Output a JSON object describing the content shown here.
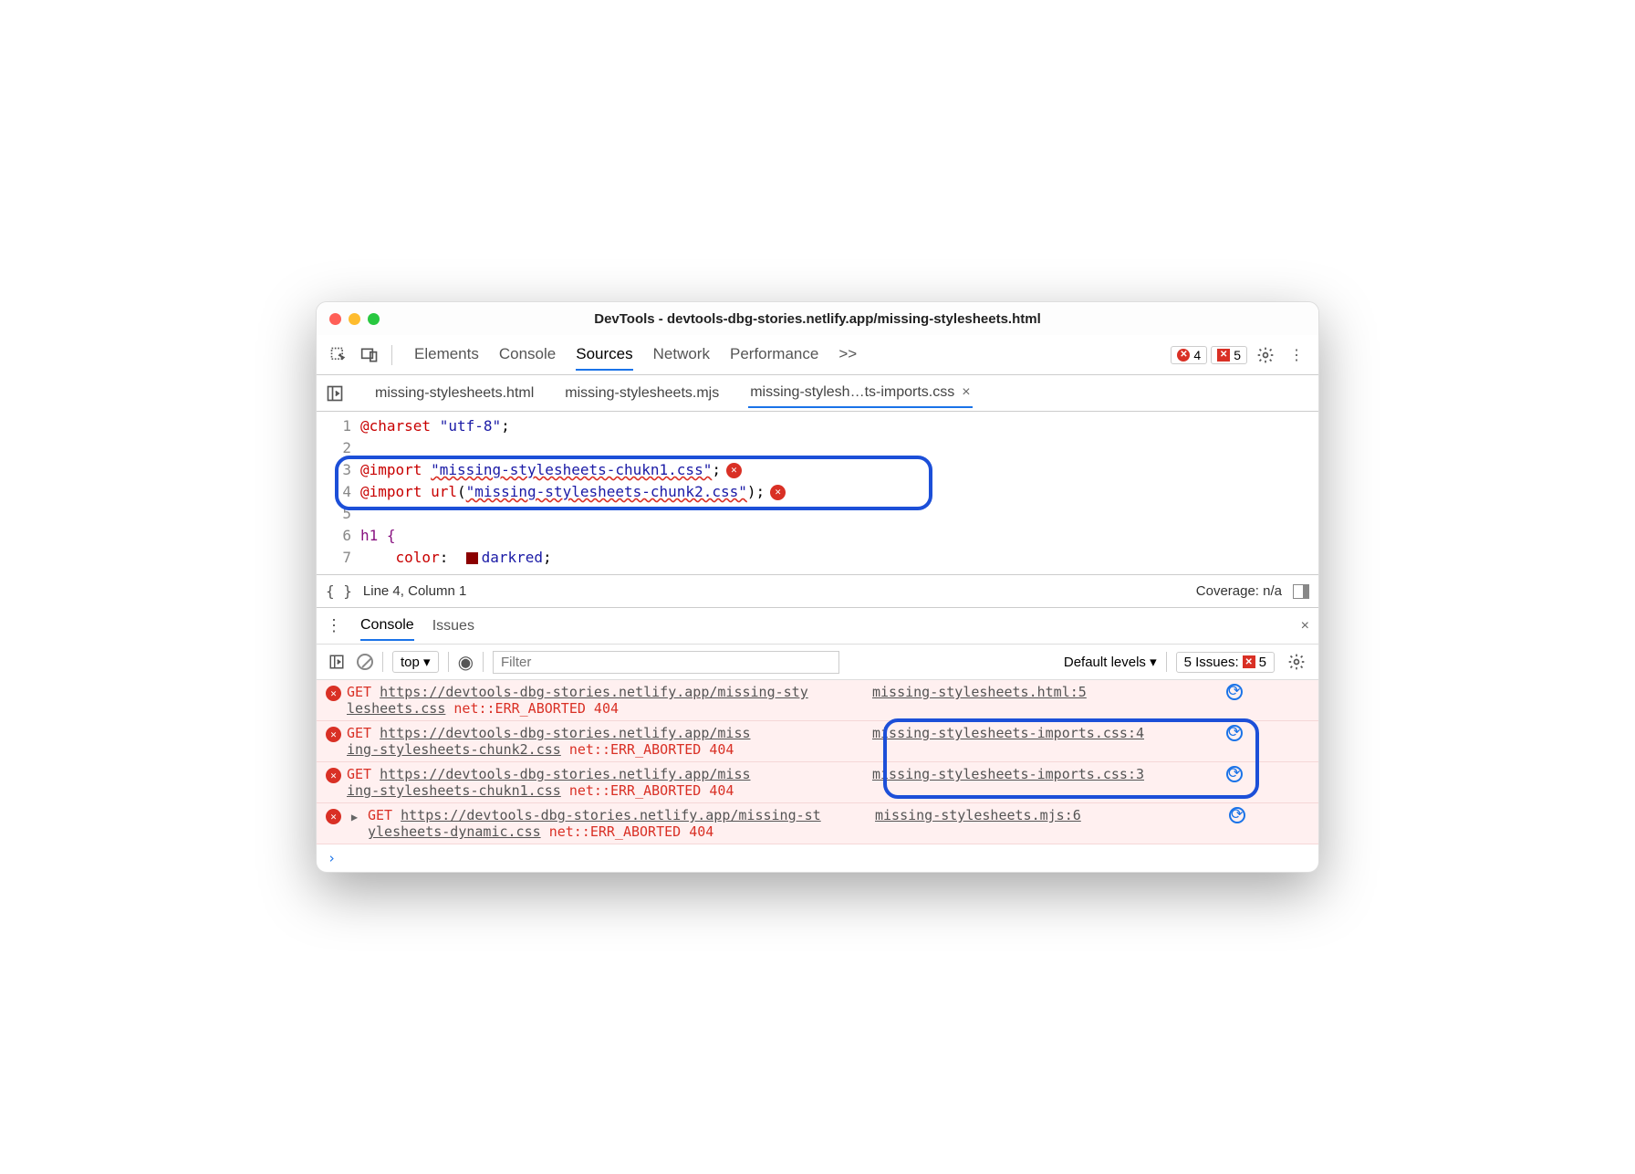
{
  "window": {
    "title": "DevTools - devtools-dbg-stories.netlify.app/missing-stylesheets.html"
  },
  "panels": {
    "items": [
      "Elements",
      "Console",
      "Sources",
      "Network",
      "Performance"
    ],
    "overflow": ">>",
    "errors": "4",
    "issues": "5"
  },
  "file_tabs": {
    "items": [
      {
        "label": "missing-stylesheets.html",
        "active": false
      },
      {
        "label": "missing-stylesheets.mjs",
        "active": false
      },
      {
        "label": "missing-stylesh…ts-imports.css",
        "active": true
      }
    ]
  },
  "source": {
    "lines": [
      "1",
      "2",
      "3",
      "4",
      "5",
      "6",
      "7"
    ],
    "l1_kw": "@charset",
    "l1_str": "\"utf-8\"",
    "l3_kw": "@import",
    "l3_str": "\"missing-stylesheets-chukn1.css\"",
    "l4_kw": "@import url",
    "l4_str": "\"missing-stylesheets-chunk2.css\"",
    "l6_sel": "h1 {",
    "l7_prop": "color",
    "l7_val": "darkred"
  },
  "status": {
    "position": "Line 4, Column 1",
    "coverage": "Coverage: n/a"
  },
  "drawer": {
    "tabs": [
      "Console",
      "Issues"
    ]
  },
  "console_toolbar": {
    "context": "top ▾",
    "filter_placeholder": "Filter",
    "levels": "Default levels ▾",
    "issues_label": "5 Issues:",
    "issues_count": "5"
  },
  "logs": [
    {
      "method": "GET",
      "url": "https://devtools-dbg-stories.netlify.app/missing-stylesheets.css",
      "url_break": "https://devtools-dbg-stories.netlify.app/missing-sty",
      "url_break2": "lesheets.css",
      "err": "net::ERR_ABORTED 404",
      "source": "missing-stylesheets.html:5"
    },
    {
      "method": "GET",
      "url_break": "https://devtools-dbg-stories.netlify.app/miss",
      "url_break2": "ing-stylesheets-chunk2.css",
      "err": "net::ERR_ABORTED 404",
      "source": "missing-stylesheets-imports.css:4"
    },
    {
      "method": "GET",
      "url_break": "https://devtools-dbg-stories.netlify.app/miss",
      "url_break2": "ing-stylesheets-chukn1.css",
      "err": "net::ERR_ABORTED 404",
      "source": "missing-stylesheets-imports.css:3"
    },
    {
      "method": "GET",
      "url_break": "https://devtools-dbg-stories.netlify.app/missing-st",
      "url_break2": "ylesheets-dynamic.css",
      "err": "net::ERR_ABORTED 404",
      "source": "missing-stylesheets.mjs:6",
      "expandable": true
    }
  ]
}
